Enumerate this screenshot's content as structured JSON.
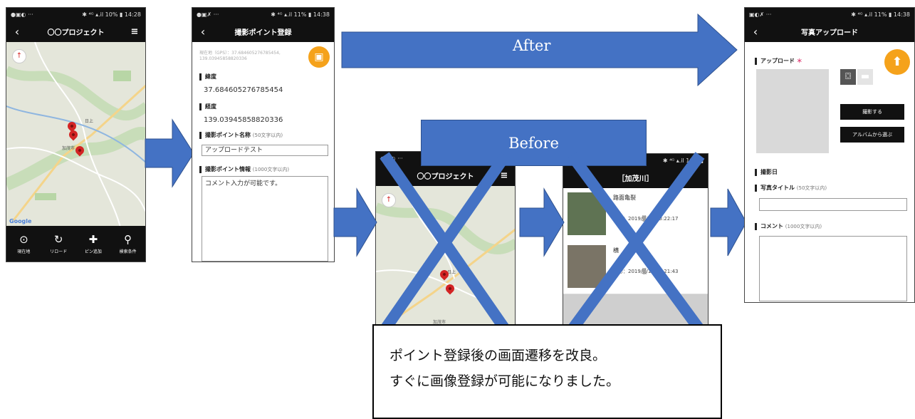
{
  "phone1": {
    "status": "✱ ⁴ᴳ ▴.il 10% ▮ 14:28",
    "title": "〇〇プロジェクト",
    "back": "‹",
    "menu": "≡",
    "map_labels": [
      "日上",
      "加茂市"
    ],
    "google": "Google",
    "nav": [
      {
        "icon": "⊙",
        "label": "現在地"
      },
      {
        "icon": "↻",
        "label": "リロード"
      },
      {
        "icon": "✚",
        "label": "ピン追加"
      },
      {
        "icon": "⚲",
        "label": "検索条件"
      }
    ]
  },
  "phone2": {
    "status": "✱ ⁴ᴳ ▴.il 11% ▮ 14:38",
    "title": "撮影ポイント登録",
    "back": "‹",
    "gps": "現在地（GPS）：37.684605276785454, 139.03945858820336",
    "lat_label": "緯度",
    "lat_value": "37.684605276785454",
    "lng_label": "経度",
    "lng_value": "139.03945858820336",
    "name_label": "撮影ポイント名称",
    "name_note": "(50文字以内)",
    "name_value": "アップロードテスト",
    "info_label": "撮影ポイント情報",
    "info_note": "(1000文字以内)",
    "info_value": "コメント入力が可能です。",
    "save_icon": "▣"
  },
  "phone3": {
    "status": "✱ ⁴ᴳ ▴.il 11% ▮ 14:38",
    "title": "写真アップロード",
    "back": "‹",
    "upload_label": "アップロード",
    "required": "＊",
    "upload_fab": "⬆",
    "camera_icon": "⌼",
    "folder_icon": "▬",
    "shoot_button": "撮影する",
    "album_button": "アルバムから選ぶ",
    "date_label": "撮影日",
    "photo_title_label": "写真タイトル",
    "photo_title_note": "(50文字以内)",
    "comment_label": "コメント",
    "comment_note": "(1000文字以内)"
  },
  "phone4": {
    "title": "〇〇プロジェクト",
    "menu": "≡",
    "map_labels": [
      "日上",
      "加茂市"
    ]
  },
  "phone5": {
    "status": "✱ ⁴ᴳ ▴.il 10% ▮",
    "title": "［加茂川］",
    "items": [
      {
        "title": "路面亀裂",
        "date": "撮影：2019/▒/18 13:22:17"
      },
      {
        "title": "横",
        "date": "撮影：2019/▒/18 13:21:43"
      }
    ]
  },
  "banners": {
    "after": "After",
    "before": "Before"
  },
  "callout": {
    "line1": "ポイント登録後の画面遷移を改良。",
    "line2": "すぐに画像登録が可能になりました。"
  },
  "colors": {
    "accent_orange": "#f5a21b",
    "arrow_blue": "#4472c4",
    "pin_red": "#d32424",
    "bar_black": "#111111"
  }
}
